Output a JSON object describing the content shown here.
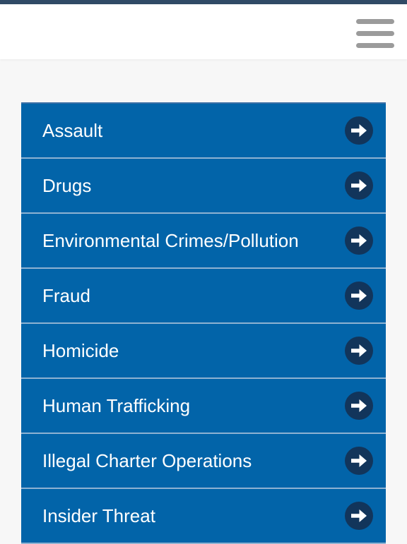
{
  "header": {
    "menu_icon": "hamburger-menu-icon"
  },
  "colors": {
    "top_strip": "#304a66",
    "list_background": "#0264a9",
    "list_divider": "#8eb2d2",
    "arrow_circle": "#12355b",
    "menu_icon": "#9b9b9b",
    "page_background": "#f7f7f7"
  },
  "categories": [
    {
      "label": "Assault",
      "icon": "arrow-right-circle-icon"
    },
    {
      "label": "Drugs",
      "icon": "arrow-right-circle-icon"
    },
    {
      "label": "Environmental Crimes/Pollution",
      "icon": "arrow-right-circle-icon"
    },
    {
      "label": "Fraud",
      "icon": "arrow-right-circle-icon"
    },
    {
      "label": "Homicide",
      "icon": "arrow-right-circle-icon"
    },
    {
      "label": "Human Trafficking",
      "icon": "arrow-right-circle-icon"
    },
    {
      "label": "Illegal Charter Operations",
      "icon": "arrow-right-circle-icon"
    },
    {
      "label": "Insider Threat",
      "icon": "arrow-right-circle-icon"
    }
  ]
}
